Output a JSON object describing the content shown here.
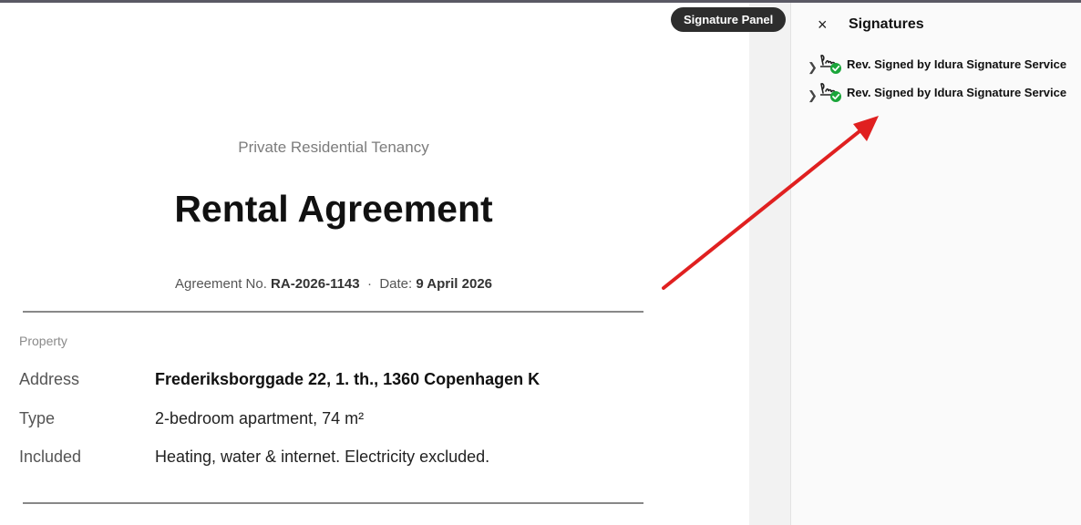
{
  "document": {
    "subtitle": "Private Residential Tenancy",
    "title": "Rental Agreement",
    "agreement_label": "Agreement No.",
    "agreement_no": "RA-2026-1143",
    "separator": "·",
    "date_label": "Date:",
    "date": "9 April 2026",
    "section": "Property",
    "fields": [
      {
        "label": "Address",
        "value": "Frederiksborggade 22, 1. th., 1360 Copenhagen K"
      },
      {
        "label": "Type",
        "value": "2-bedroom apartment, 74 m²"
      },
      {
        "label": "Included",
        "value": "Heating, water & internet. Electricity excluded."
      }
    ]
  },
  "toolbar": {
    "signature_panel_button": "Signature Panel"
  },
  "panel": {
    "close_icon": "×",
    "title": "Signatures",
    "signatures": [
      {
        "label": "Rev. Signed by Idura Signature Service",
        "status": "valid"
      },
      {
        "label": "Rev. Signed by Idura Signature Service",
        "status": "valid"
      }
    ]
  },
  "colors": {
    "annotation_arrow": "#e02020",
    "valid_check": "#1aa53a",
    "button_bg": "#2d2d2d"
  }
}
